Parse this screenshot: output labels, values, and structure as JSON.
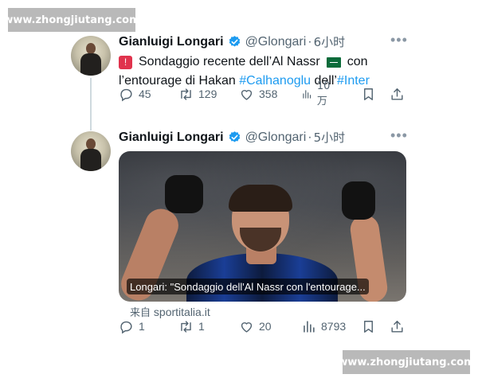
{
  "watermark": {
    "text": "www.zhongjiutang.com"
  },
  "tweets": [
    {
      "author": {
        "name": "Gianluigi Longari",
        "handle": "@Glongari"
      },
      "separator": "·",
      "time": "6小时",
      "text": {
        "line1_before_flag": "Sondaggio recente dell’Al Nassr",
        "line1_after_flag": "con",
        "line2_prefix": "l’entourage di Hakan ",
        "hashtag1": "#Calhanoglu",
        "line2_middle": " dell’",
        "hashtag2": "#Inter"
      },
      "stats": {
        "replies": "45",
        "retweets": "129",
        "likes": "358",
        "views": "10万"
      }
    },
    {
      "author": {
        "name": "Gianluigi Longari",
        "handle": "@Glongari"
      },
      "separator": "·",
      "time": "5小时",
      "media": {
        "caption": "Longari: \"Sondaggio dell'Al Nassr con l'entourage..."
      },
      "source": {
        "prefix": "来自",
        "domain": "sportitalia.it"
      },
      "stats": {
        "replies": "1",
        "retweets": "1",
        "likes": "20",
        "views": "8793"
      }
    }
  ],
  "icons": {
    "verified": "verified-badge-icon",
    "reply": "reply-icon",
    "retweet": "retweet-icon",
    "like": "heart-icon",
    "views": "views-icon",
    "bookmark": "bookmark-icon",
    "share": "share-icon",
    "more": "more-icon"
  },
  "colors": {
    "link": "#1d9bf0",
    "verified": "#1d9bf0",
    "muted": "#536471",
    "watermark_bg": "#b9b9b9"
  }
}
